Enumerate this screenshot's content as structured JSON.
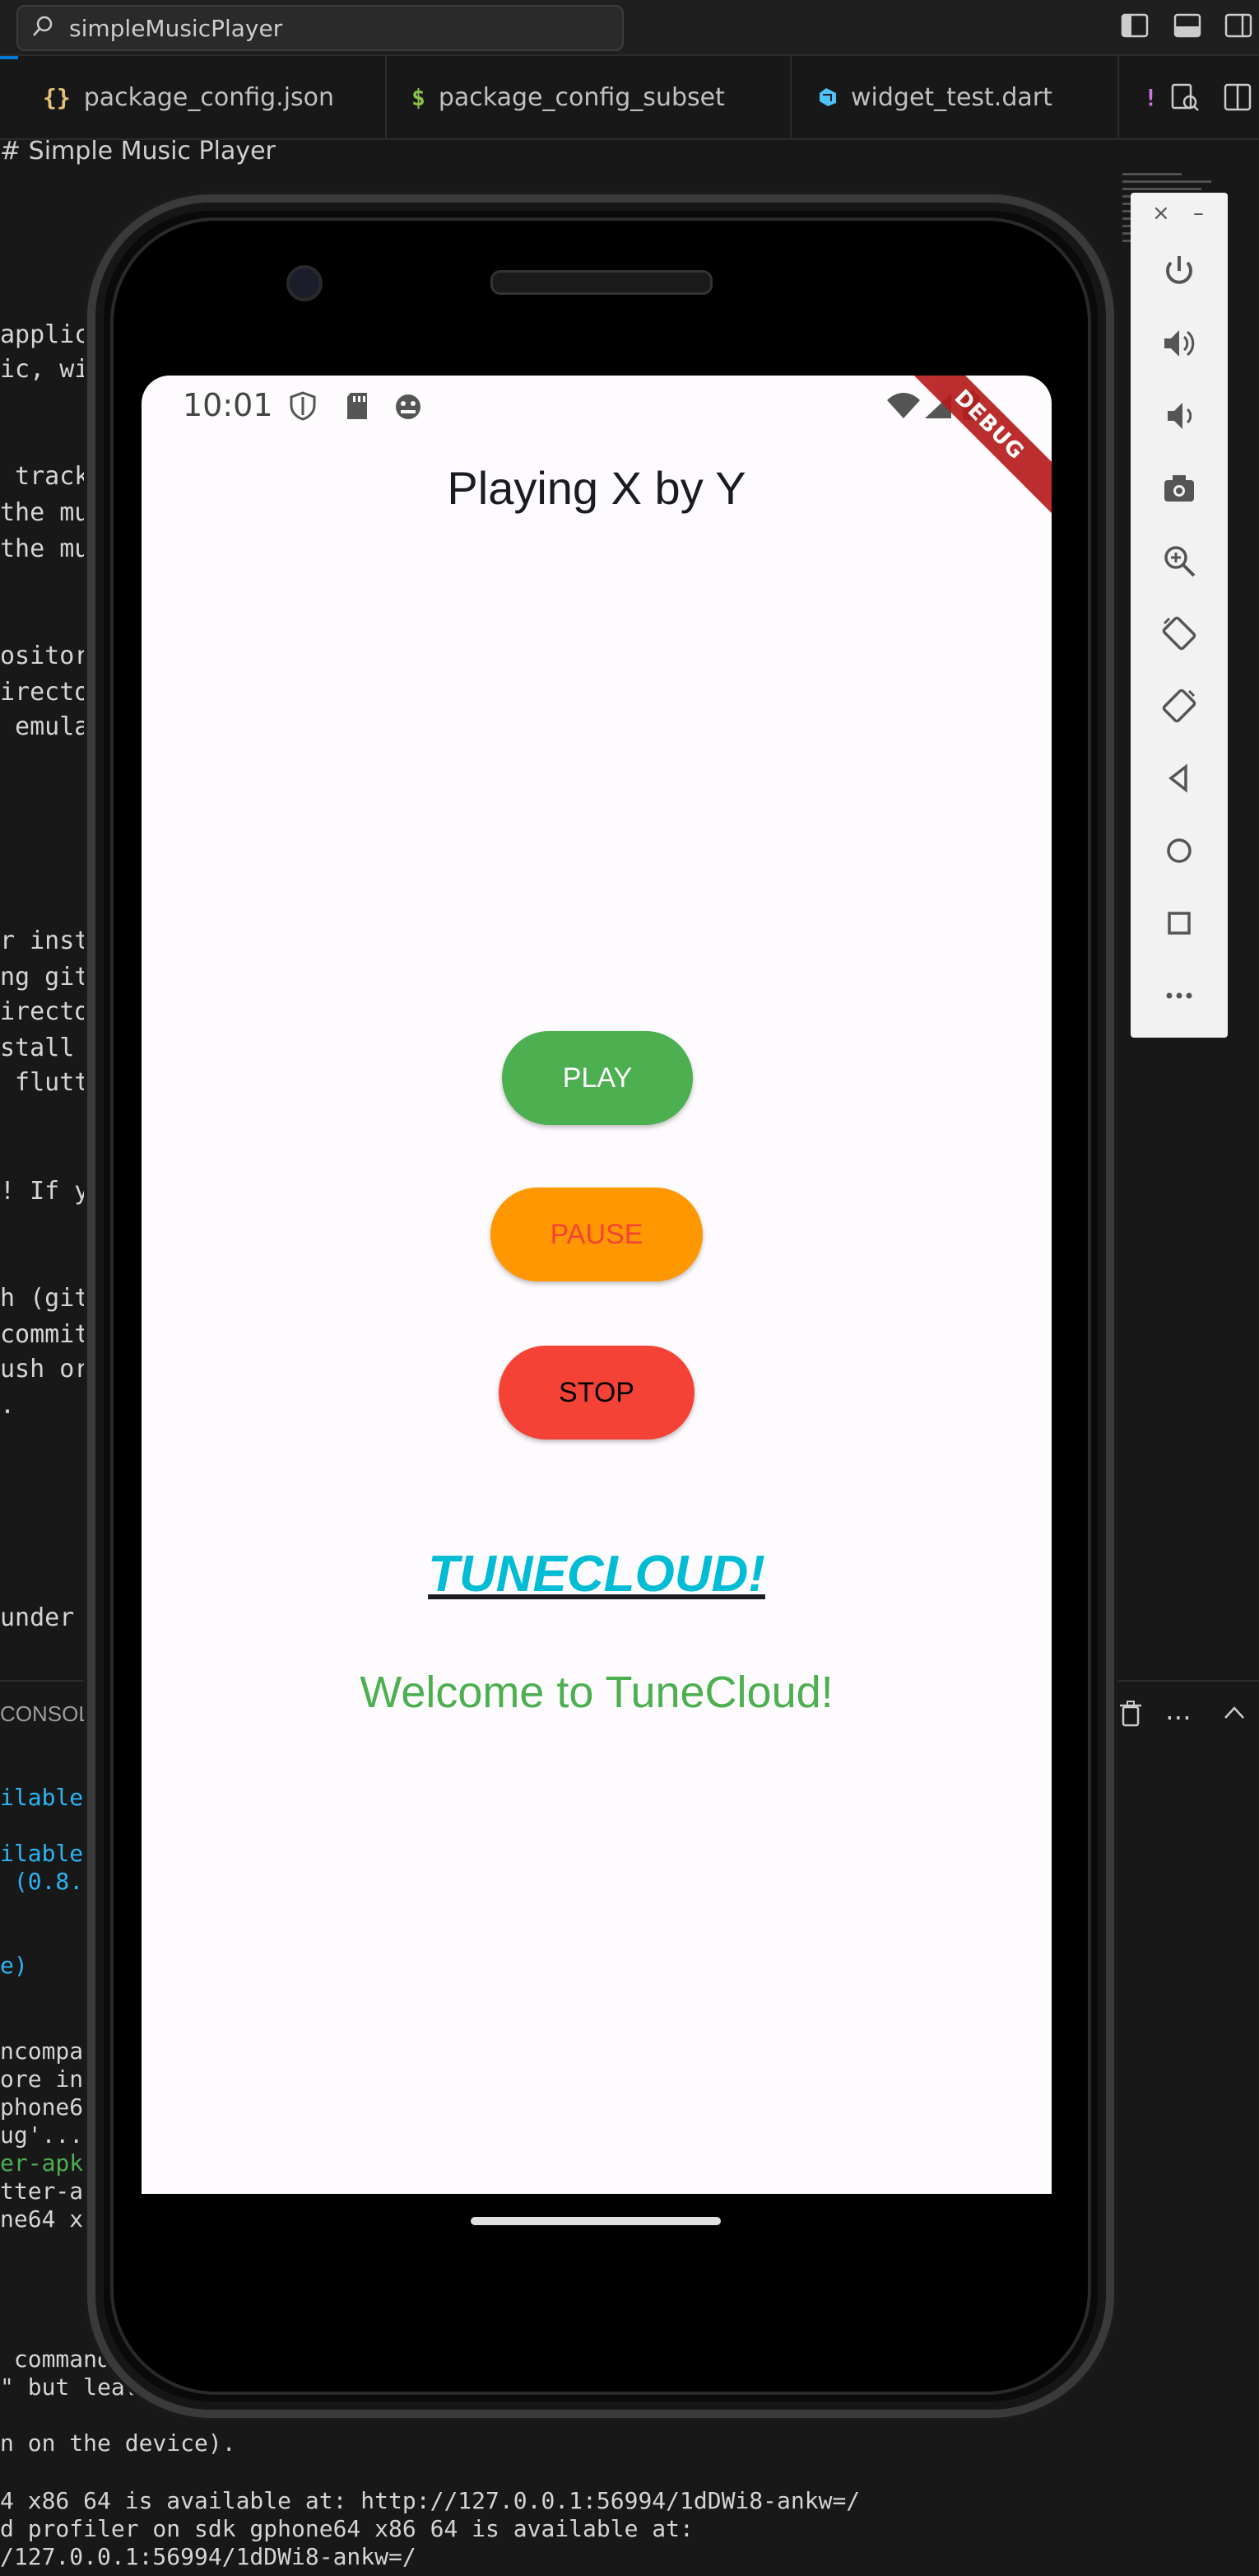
{
  "vscode": {
    "search_text": "simpleMusicPlayer",
    "tabs": [
      {
        "icon": "{}",
        "icon_color": "#e5c07b",
        "label": "package_config.json"
      },
      {
        "icon": "$",
        "icon_color": "#8bc34a",
        "label": "package_config_subset"
      },
      {
        "icon": "",
        "icon_color": "#4fc3f7",
        "label": "widget_test.dart"
      },
      {
        "icon": "!",
        "icon_color": "#c678dd",
        "label": ""
      }
    ],
    "breadcrumb": "# Simple Music Player",
    "editor_lines": [
      {
        "text": "applic",
        "color": "#d4d4d4"
      },
      {
        "text": "ic, wi",
        "color": "#d4d4d4"
      },
      {
        "text": " track",
        "color": "#d4d4d4"
      },
      {
        "text": "the mu",
        "color": "#d4d4d4"
      },
      {
        "text": "the mu",
        "color": "#d4d4d4"
      },
      {
        "text": "ositor",
        "color": "#d4d4d4"
      },
      {
        "text": "irecto",
        "color": "#d4d4d4"
      },
      {
        "text": " emula",
        "color": "#d4d4d4"
      },
      {
        "text": "r inst",
        "color": "#d4d4d4"
      },
      {
        "text": "ng git",
        "color": "#d4d4d4"
      },
      {
        "text": "irecto",
        "color": "#d4d4d4"
      },
      {
        "text": "stall ",
        "color": "#d4d4d4"
      },
      {
        "text": " flutt",
        "color": "#d4d4d4"
      },
      {
        "text": "! If y",
        "color": "#d4d4d4"
      },
      {
        "text": "h (git",
        "color": "#d4d4d4"
      },
      {
        "text": "commit",
        "color": "#d4d4d4"
      },
      {
        "text": "ush or",
        "color": "#d4d4d4"
      },
      {
        "text": ".",
        "color": "#d4d4d4"
      },
      {
        "text": "under ",
        "color": "#d4d4d4"
      }
    ],
    "panel_label": "CONSOLE",
    "terminal_lines": [
      {
        "text": "ilable",
        "color": "#29b6f6"
      },
      {
        "text": "ilable",
        "color": "#29b6f6"
      },
      {
        "text": " (0.8.",
        "color": "#29b6f6"
      },
      {
        "text": "e)",
        "color": "#29b6f6"
      },
      {
        "text": "ncompa",
        "color": "#d4d4d4"
      },
      {
        "text": "ore in",
        "color": "#d4d4d4"
      },
      {
        "text": "phone6",
        "color": "#d4d4d4"
      },
      {
        "text": "ug'...",
        "color": "#d4d4d4"
      },
      {
        "text": "er-apk",
        "color": "#4caf50"
      },
      {
        "text": "tter-a",
        "color": "#d4d4d4"
      },
      {
        "text": "ne64 x",
        "color": "#d4d4d4"
      },
      {
        "text": " command",
        "color": "#d4d4d4"
      },
      {
        "text": "\" but leav",
        "color": "#d4d4d4"
      },
      {
        "text": "n on the device).",
        "color": "#d4d4d4"
      },
      {
        "text": "4 x86 64 is available at: http://127.0.0.1:56994/1dDWi8-ankw=/",
        "color": "#d4d4d4"
      },
      {
        "text": "d profiler on sdk gphone64 x86 64 is available at:",
        "color": "#d4d4d4"
      },
      {
        "text": "/127.0.0.1:56994/1dDWi8-ankw=/",
        "color": "#d4d4d4"
      }
    ]
  },
  "phone": {
    "status_time": "10:01",
    "debug_banner": "DEBUG",
    "app": {
      "title": "Playing X by Y",
      "play_label": "PLAY",
      "pause_label": "PAUSE",
      "stop_label": "STOP",
      "brand": "TUNECLOUD!",
      "welcome": "Welcome to TuneCloud!"
    },
    "colors": {
      "play_bg": "#4caf50",
      "play_fg": "#ffffff",
      "pause_bg": "#ff9800",
      "pause_fg": "#f44336",
      "stop_bg": "#f44336",
      "stop_fg": "#000000",
      "brand": "#00bcd4",
      "welcome": "#4caf50"
    }
  },
  "emulator_toolbar": {
    "close": "×",
    "minimize": "–",
    "buttons": [
      "power-icon",
      "volume-up-icon",
      "volume-down-icon",
      "camera-icon",
      "zoom-icon",
      "rotate-left-icon",
      "rotate-right-icon",
      "back-icon",
      "home-icon",
      "overview-icon",
      "more-icon"
    ]
  }
}
